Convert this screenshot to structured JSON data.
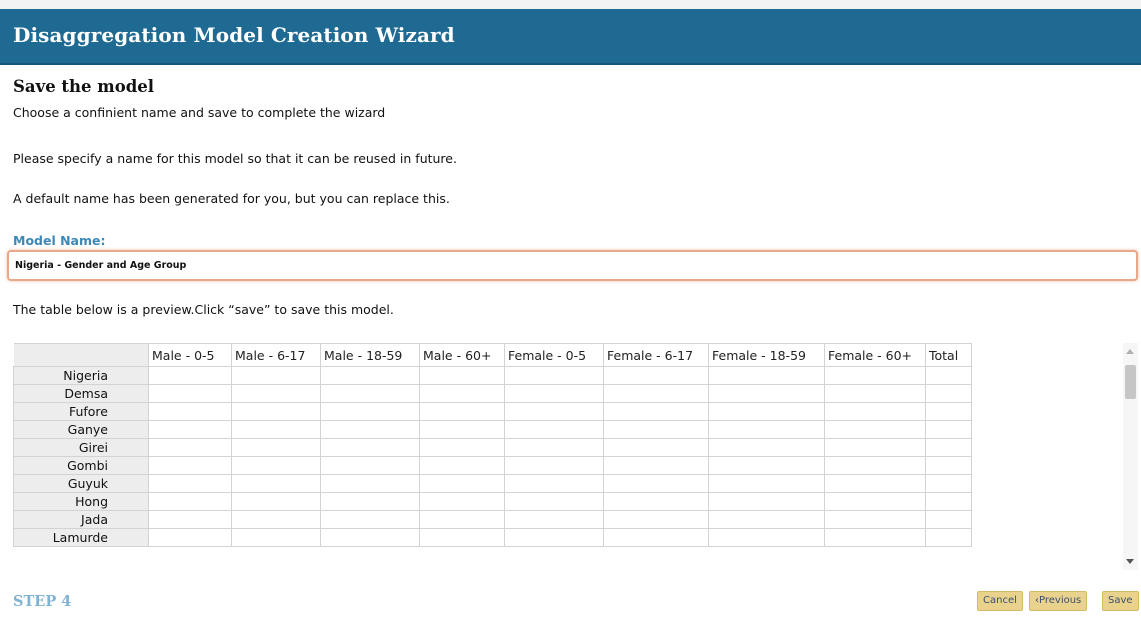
{
  "header": {
    "title": "Disaggregation Model Creation Wizard"
  },
  "section": {
    "title": "Save the model",
    "subtitle": "Choose a confinient name and save to complete the wizard",
    "para1": "Please specify a name for this model so that it can be reused in future.",
    "para2": "A default name has been generated for you, but you can replace this."
  },
  "form": {
    "label": "Model Name:",
    "value": "Nigeria - Gender and Age Group"
  },
  "preview_note": "The table below is a preview.Click “save” to save this model.",
  "table": {
    "columns": [
      "Male - 0-5",
      "Male - 6-17",
      "Male - 18-59",
      "Male - 60+",
      "Female - 0-5",
      "Female - 6-17",
      "Female - 18-59",
      "Female - 60+",
      "Total"
    ],
    "rows": [
      "Nigeria",
      "Demsa",
      "Fufore",
      "Ganye",
      "Girei",
      "Gombi",
      "Guyuk",
      "Hong",
      "Jada",
      "Lamurde"
    ]
  },
  "footer": {
    "step": "STEP 4",
    "cancel": "Cancel",
    "previous": "‹Previous",
    "save": "Save"
  },
  "colors": {
    "header_bg": "#1f6a92",
    "label_blue": "#3d88b6",
    "button_bg": "#e9d28b",
    "input_border": "#e8a88a"
  }
}
